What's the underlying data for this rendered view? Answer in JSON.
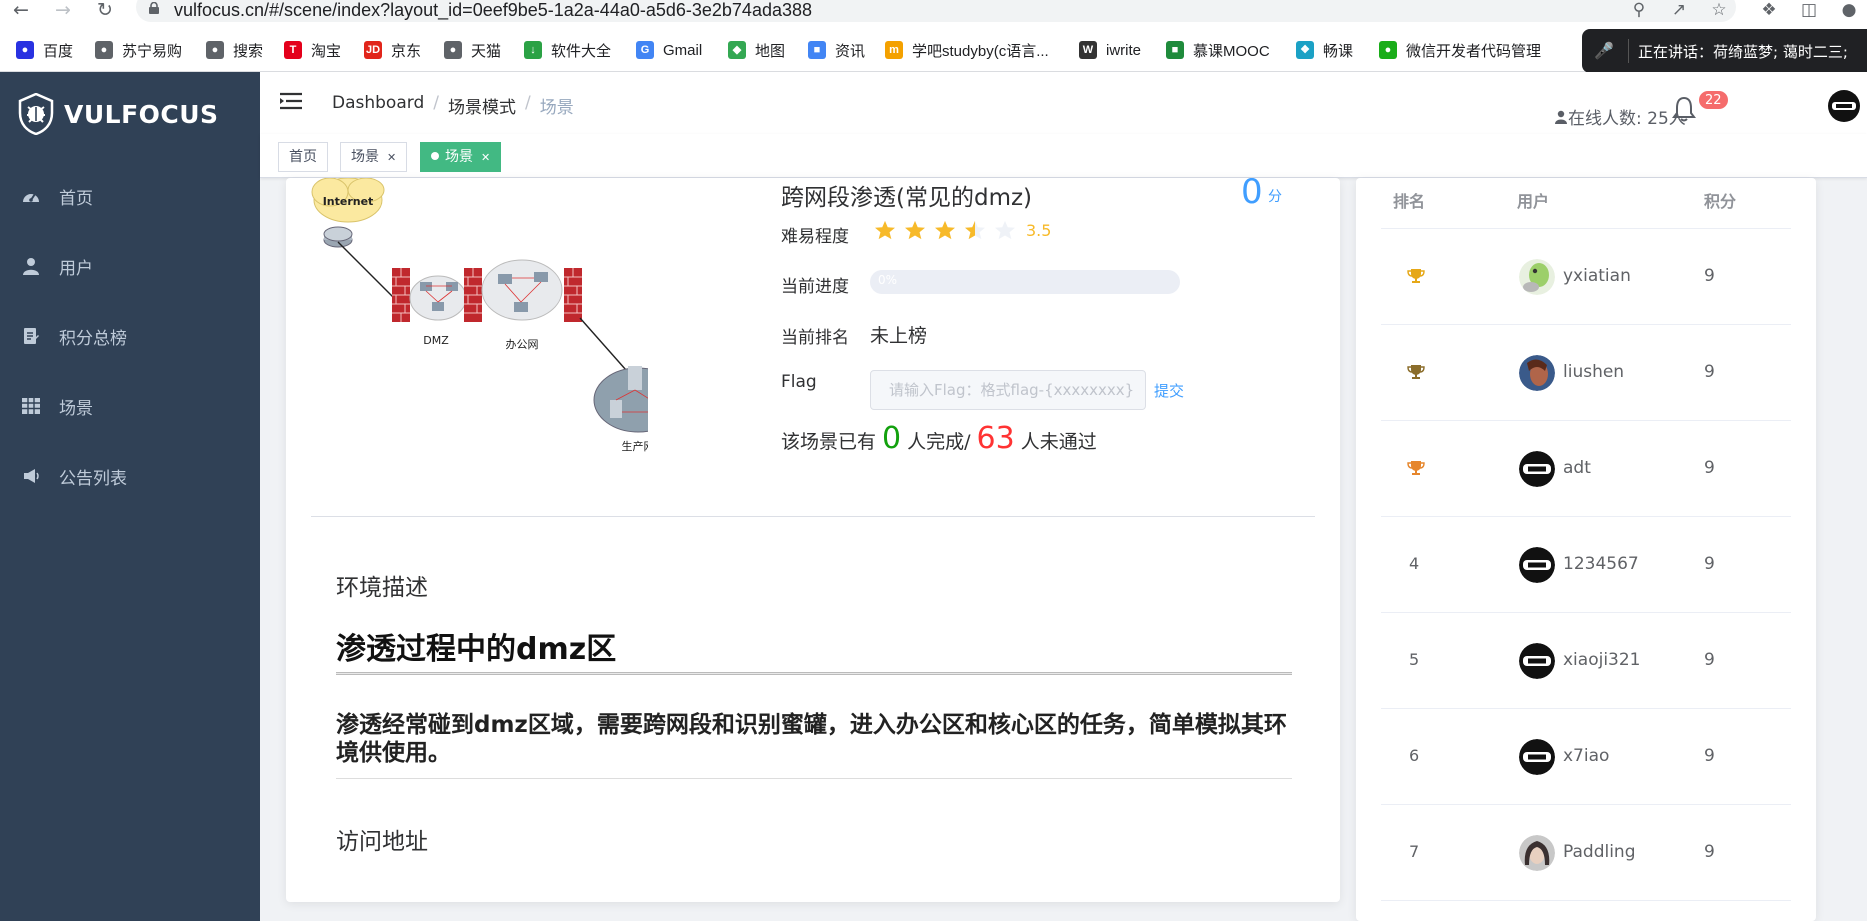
{
  "browser": {
    "url": "vulfocus.cn/#/scene/index?layout_id=0eef9be5-1a2a-44a0-a5d6-3e2b74ada388",
    "bookmarks": [
      {
        "label": "百度",
        "icon": "baidu-icon",
        "color": "#2932e1"
      },
      {
        "label": "苏宁易购",
        "icon": "globe-icon",
        "color": "#5f6368"
      },
      {
        "label": "搜索",
        "icon": "globe-icon",
        "color": "#5f6368"
      },
      {
        "label": "淘宝",
        "icon": "taobao-icon",
        "color": "#e4001b"
      },
      {
        "label": "京东",
        "icon": "jd-icon",
        "color": "#e1251b"
      },
      {
        "label": "天猫",
        "icon": "globe-icon",
        "color": "#5f6368"
      },
      {
        "label": "软件大全",
        "icon": "download-icon",
        "color": "#2ba245"
      },
      {
        "label": "Gmail",
        "icon": "google-icon",
        "color": "#4285f4"
      },
      {
        "label": "地图",
        "icon": "maps-icon",
        "color": "#34a853"
      },
      {
        "label": "资讯",
        "icon": "news-icon",
        "color": "#4285f4"
      },
      {
        "label": "学吧studyby(c语言...",
        "icon": "studyby-icon",
        "color": "#f4a100"
      },
      {
        "label": "iwrite",
        "icon": "iwrite-icon",
        "color": "#333333"
      },
      {
        "label": "慕课MOOC",
        "icon": "mooc-icon",
        "color": "#1f8b3c"
      },
      {
        "label": "畅课",
        "icon": "changke-icon",
        "color": "#1ba1c5"
      },
      {
        "label": "微信开发者代码管理",
        "icon": "wechat-icon",
        "color": "#1aad19"
      }
    ],
    "live_banner": "正在讲话：荷绮蓝梦; 蔼时二三;"
  },
  "sidebar": {
    "logo_text": "VULFOCUS",
    "items": [
      {
        "label": "首页",
        "icon": "dashboard-icon"
      },
      {
        "label": "用户",
        "icon": "user-icon"
      },
      {
        "label": "积分总榜",
        "icon": "ranking-icon"
      },
      {
        "label": "场景",
        "icon": "table-icon"
      },
      {
        "label": "公告列表",
        "icon": "megaphone-icon"
      }
    ]
  },
  "navbar": {
    "breadcrumb": [
      "Dashboard",
      "场景模式",
      "场景"
    ],
    "online_label": "在线人数: 25人",
    "notification_count": "22"
  },
  "tags": [
    {
      "label": "首页",
      "active": false
    },
    {
      "label": "场景",
      "active": false,
      "closable": true
    },
    {
      "label": "场景",
      "active": true,
      "closable": true
    }
  ],
  "scene": {
    "title": "跨网段渗透(常见的dmz)",
    "score": "0",
    "score_unit": "分",
    "difficulty_label": "难易程度",
    "rating": 3.5,
    "rating_text": "3.5",
    "progress_label": "当前进度",
    "progress_text": "0%",
    "progress_percent": 0,
    "rank_label": "当前排名",
    "rank_value": "未上榜",
    "flag_label": "Flag",
    "flag_placeholder": "请输入Flag：格式flag-{xxxxxxxx}",
    "submit_label": "提交",
    "completion_prefix": "该场景已有",
    "completed_count": "0",
    "completion_mid": "人完成/",
    "failed_count": "63",
    "completion_suffix": "人未通过",
    "diagram": {
      "internet": "Internet",
      "dmz": "DMZ",
      "office": "办公网",
      "production": "生产网"
    }
  },
  "description": {
    "heading": "环境描述",
    "title": "渗透过程中的dmz区",
    "body": "渗透经常碰到dmz区域，需要跨网段和识别蜜罐，进入办公区和核心区的任务，简单模拟其环境供使用。",
    "access_heading": "访问地址"
  },
  "leaderboard": {
    "headers": [
      "排名",
      "用户",
      "积分"
    ],
    "rows": [
      {
        "rank": "",
        "medal": "gold",
        "user": "yxiatian",
        "score": "9",
        "avatar": "green"
      },
      {
        "rank": "",
        "medal": "silver",
        "user": "liushen",
        "score": "9",
        "avatar": "photo"
      },
      {
        "rank": "",
        "medal": "bronze",
        "user": "adt",
        "score": "9",
        "avatar": "default"
      },
      {
        "rank": "4",
        "medal": "",
        "user": "1234567",
        "score": "9",
        "avatar": "default"
      },
      {
        "rank": "5",
        "medal": "",
        "user": "xiaoji321",
        "score": "9",
        "avatar": "default"
      },
      {
        "rank": "6",
        "medal": "",
        "user": "x7iao",
        "score": "9",
        "avatar": "default"
      },
      {
        "rank": "7",
        "medal": "",
        "user": "Paddling",
        "score": "9",
        "avatar": "photo2"
      }
    ]
  },
  "colors": {
    "sidebar_bg": "#304156",
    "accent_green": "#42b983",
    "link_blue": "#409eff",
    "star_yellow": "#f7ba2a",
    "badge_red": "#f56c6c"
  }
}
